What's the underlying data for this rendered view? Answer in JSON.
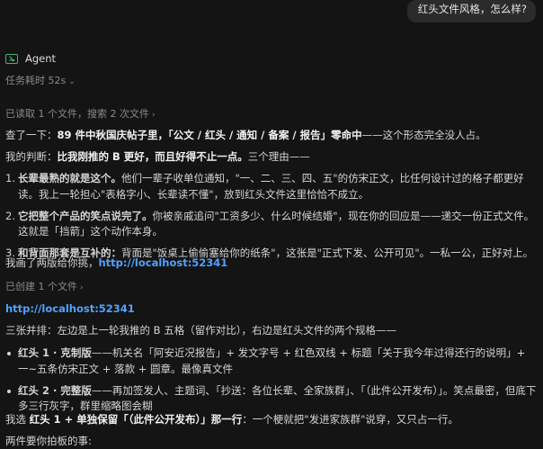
{
  "user_message": "红头文件风格，怎么样?",
  "agent": {
    "name": "Agent",
    "elapsed": "任务耗时 52s",
    "read_summary": "已读取 1 个文件，搜索 2 次文件",
    "p1": {
      "pre": "查了一下：",
      "bold": "89 件中秋国庆帖子里，「公文 / 红头 / 通知 / 备案 / 报告」零命中",
      "post": "——这个形态完全没人占。"
    },
    "p2": {
      "pre": "我的判断：",
      "bold": "比我刚推的 B 更好，而且好得不止一点。",
      "post": "三个理由——"
    },
    "reasons": [
      {
        "num": "1.",
        "bold": "长辈最熟的就是这个。",
        "text": "他们一辈子收单位通知，\"一、二、三、四、五\"的仿宋正文，比任何设计过的格子都更好读。我上一轮担心\"表格字小、长辈读不懂\"，放到红头文件这里恰恰不成立。"
      },
      {
        "num": "2.",
        "bold": "它把整个产品的笑点说完了。",
        "text": "你被亲戚追问\"工资多少、什么时候结婚\"，现在你的回应是——递交一份正式文件。这就是「挡箭」这个动作本身。"
      },
      {
        "num": "3.",
        "bold": "和背面那套是互补的：",
        "text": "背面是\"饭桌上偷偷塞给你的纸条\"，这张是\"正式下发、公开可见\"。一私一公，正好对上。"
      }
    ],
    "p3": {
      "pre": "我画了两版给你挑，",
      "link": "http://localhost:52341"
    },
    "created_summary": "已创建 1 个文件",
    "link2": "http://localhost:52341",
    "p4": "三张并排：左边是上一轮我推的 B 五格（留作对比），右边是红头文件的两个规格——",
    "variants": [
      {
        "bold": "红头 1 · 克制版",
        "text": "——机关名「阿安近况报告」+ 发文字号 + 红色双线 + 标题「关于我今年过得还行的说明」+ 一~五条仿宋正文 + 落款 + 圆章。最像真文件"
      },
      {
        "bold": "红头 2 · 完整版",
        "text": "——再加签发人、主题词、「抄送：各位长辈、全家族群」、「（此件公开发布）」。笑点最密，但底下多三行灰字，群里缩略图会糊"
      }
    ],
    "p5": {
      "pre": "我选 ",
      "bold": "红头 1 + 单独保留「（此件公开发布）」那一行",
      "post": "：一个梗就把\"发进家族群\"说穿，又只占一行。"
    },
    "p6": "两件要你拍板的事:"
  }
}
